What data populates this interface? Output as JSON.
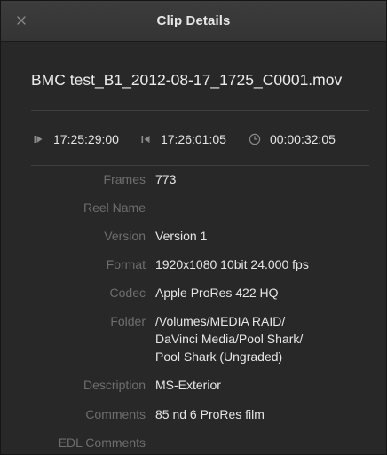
{
  "window": {
    "title": "Clip Details"
  },
  "clip": {
    "filename": "BMC test_B1_2012-08-17_1725_C0001.mov"
  },
  "timecodes": {
    "start": "17:25:29:00",
    "end": "17:26:01:05",
    "duration": "00:00:32:05"
  },
  "properties": [
    {
      "label": "Frames",
      "value": "773"
    },
    {
      "label": "Reel Name",
      "value": ""
    },
    {
      "label": "Version",
      "value": "Version 1"
    },
    {
      "label": "Format",
      "value": "1920x1080 10bit 24.000 fps"
    },
    {
      "label": "Codec",
      "value": "Apple ProRes 422 HQ"
    },
    {
      "label": "Folder",
      "value": "/Volumes/MEDIA RAID/"
    },
    {
      "label": "",
      "value": "DaVinci Media/Pool Shark/"
    },
    {
      "label": "",
      "value": "Pool Shark (Ungraded)"
    },
    {
      "label": "Description",
      "value": "MS-Exterior"
    },
    {
      "label": "Comments",
      "value": "85 nd 6 ProRes film"
    },
    {
      "label": "EDL Comments",
      "value": ""
    }
  ],
  "icons": {
    "close": "close-icon",
    "start": "play-start-icon",
    "end": "skip-back-icon",
    "duration": "clock-icon"
  },
  "colors": {
    "background": "#282828",
    "titlebar": "#363636",
    "label": "#6e6e6e",
    "value": "#e6e6e6"
  }
}
